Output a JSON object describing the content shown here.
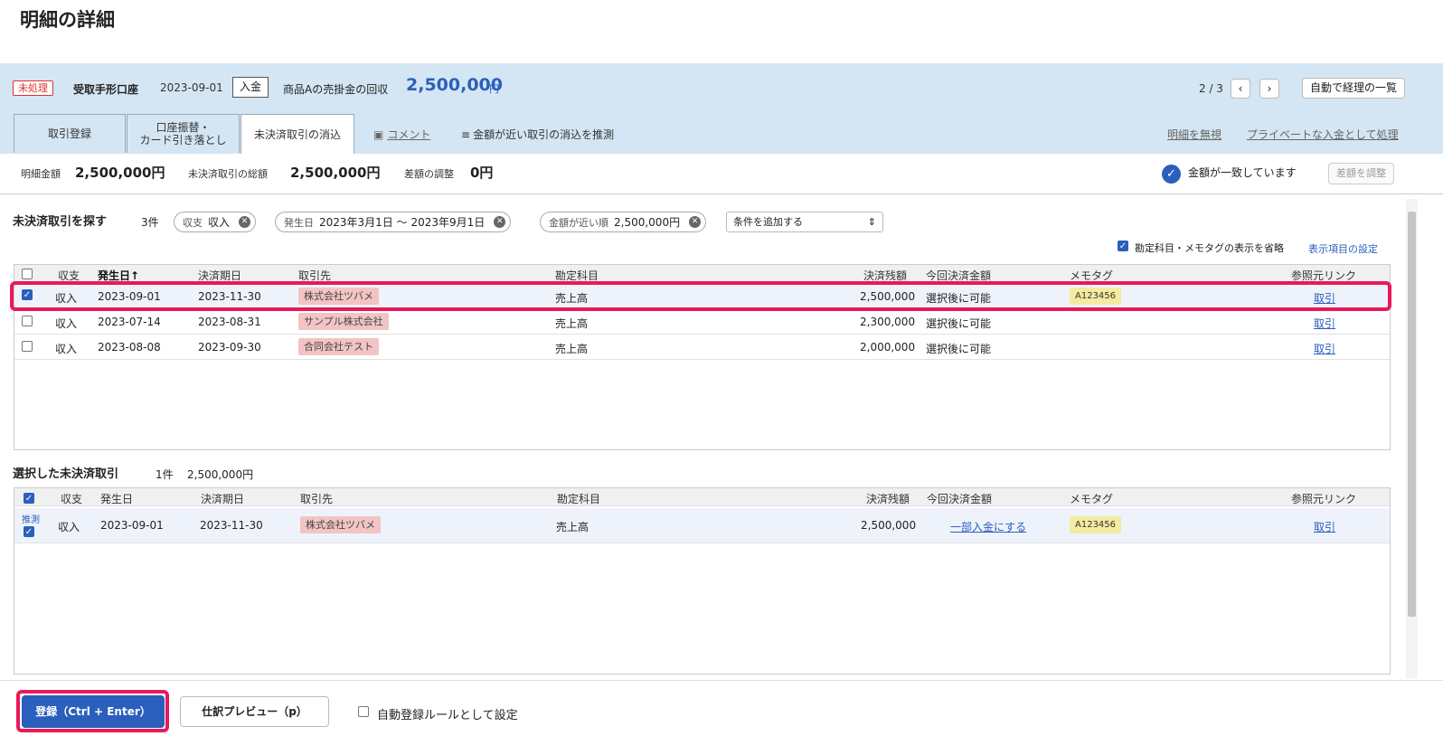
{
  "page": {
    "title": "明細の詳細"
  },
  "statement": {
    "status": "未処理",
    "account": "受取手形口座",
    "date": "2023-09-01",
    "direction": "入金",
    "description": "商品Aの売掛金の回収",
    "amount": "2,500,000",
    "amount_unit": "円",
    "pager": "2 / 3",
    "prev_icon": "chevron-left",
    "next_icon": "chevron-right",
    "auto_list_label": "自動で経理の一覧"
  },
  "tabs": [
    {
      "label": "取引登録"
    },
    {
      "label_line1": "口座振替・",
      "label_line2": "カード引き落とし"
    },
    {
      "label": "未決済取引の消込"
    }
  ],
  "tab_links": {
    "comment": "コメント",
    "guess": "金額が近い取引の消込を推測",
    "ignore": "明細を無視",
    "private": "プライベートな入金として処理"
  },
  "summary": {
    "stmt_amount_label": "明細金額",
    "stmt_amount": "2,500,000円",
    "unsettled_total_label": "未決済取引の総額",
    "unsettled_total": "2,500,000円",
    "diff_label": "差額の調整",
    "diff": "0円",
    "match_text": "金額が一致しています",
    "adjust_button": "差額を調整"
  },
  "search": {
    "title": "未決済取引を探す",
    "count": "3件",
    "chips": [
      {
        "label": "収支",
        "value": "収入"
      },
      {
        "label": "発生日",
        "value": "2023年3月1日 〜 2023年9月1日"
      },
      {
        "label": "金額が近い順",
        "value": "2,500,000円"
      }
    ],
    "add_condition": "条件を追加する",
    "omit_label": "勘定科目・メモタグの表示を省略",
    "display_settings": "表示項目の設定"
  },
  "columns": {
    "io": "収支",
    "issue_date": "発生日",
    "due_date": "決済期日",
    "partner": "取引先",
    "account": "勘定科目",
    "balance": "決済残額",
    "this_amount": "今回決済金額",
    "memo": "メモタグ",
    "ref": "参照元リンク"
  },
  "sort_indicator": "↑",
  "rows": [
    {
      "checked": true,
      "io": "収入",
      "issue_date": "2023-09-01",
      "due_date": "2023-11-30",
      "partner": "株式会社ツバメ",
      "account": "売上高",
      "balance": "2,500,000",
      "this_amount": "選択後に可能",
      "memo": "A123456",
      "ref": "取引"
    },
    {
      "checked": false,
      "io": "収入",
      "issue_date": "2023-07-14",
      "due_date": "2023-08-31",
      "partner": "サンプル株式会社",
      "account": "売上高",
      "balance": "2,300,000",
      "this_amount": "選択後に可能",
      "memo": "",
      "ref": "取引"
    },
    {
      "checked": false,
      "io": "収入",
      "issue_date": "2023-08-08",
      "due_date": "2023-09-30",
      "partner": "合同会社テスト",
      "account": "売上高",
      "balance": "2,000,000",
      "this_amount": "選択後に可能",
      "memo": "",
      "ref": "取引"
    }
  ],
  "selected": {
    "title": "選択した未決済取引",
    "count": "1件",
    "total": "2,500,000円",
    "row": {
      "guess_label": "推測",
      "io": "収入",
      "issue_date": "2023-09-01",
      "due_date": "2023-11-30",
      "partner": "株式会社ツバメ",
      "account": "売上高",
      "balance": "2,500,000",
      "this_amount": "一部入金にする",
      "memo": "A123456",
      "ref": "取引"
    }
  },
  "footer": {
    "register": "登録（Ctrl + Enter）",
    "preview": "仕訳プレビュー（p）",
    "auto_rule": "自動登録ルールとして設定"
  },
  "colors": {
    "accent": "#2b5fbd",
    "highlight": "#e8195a",
    "header_bg": "#d4e6f3"
  }
}
